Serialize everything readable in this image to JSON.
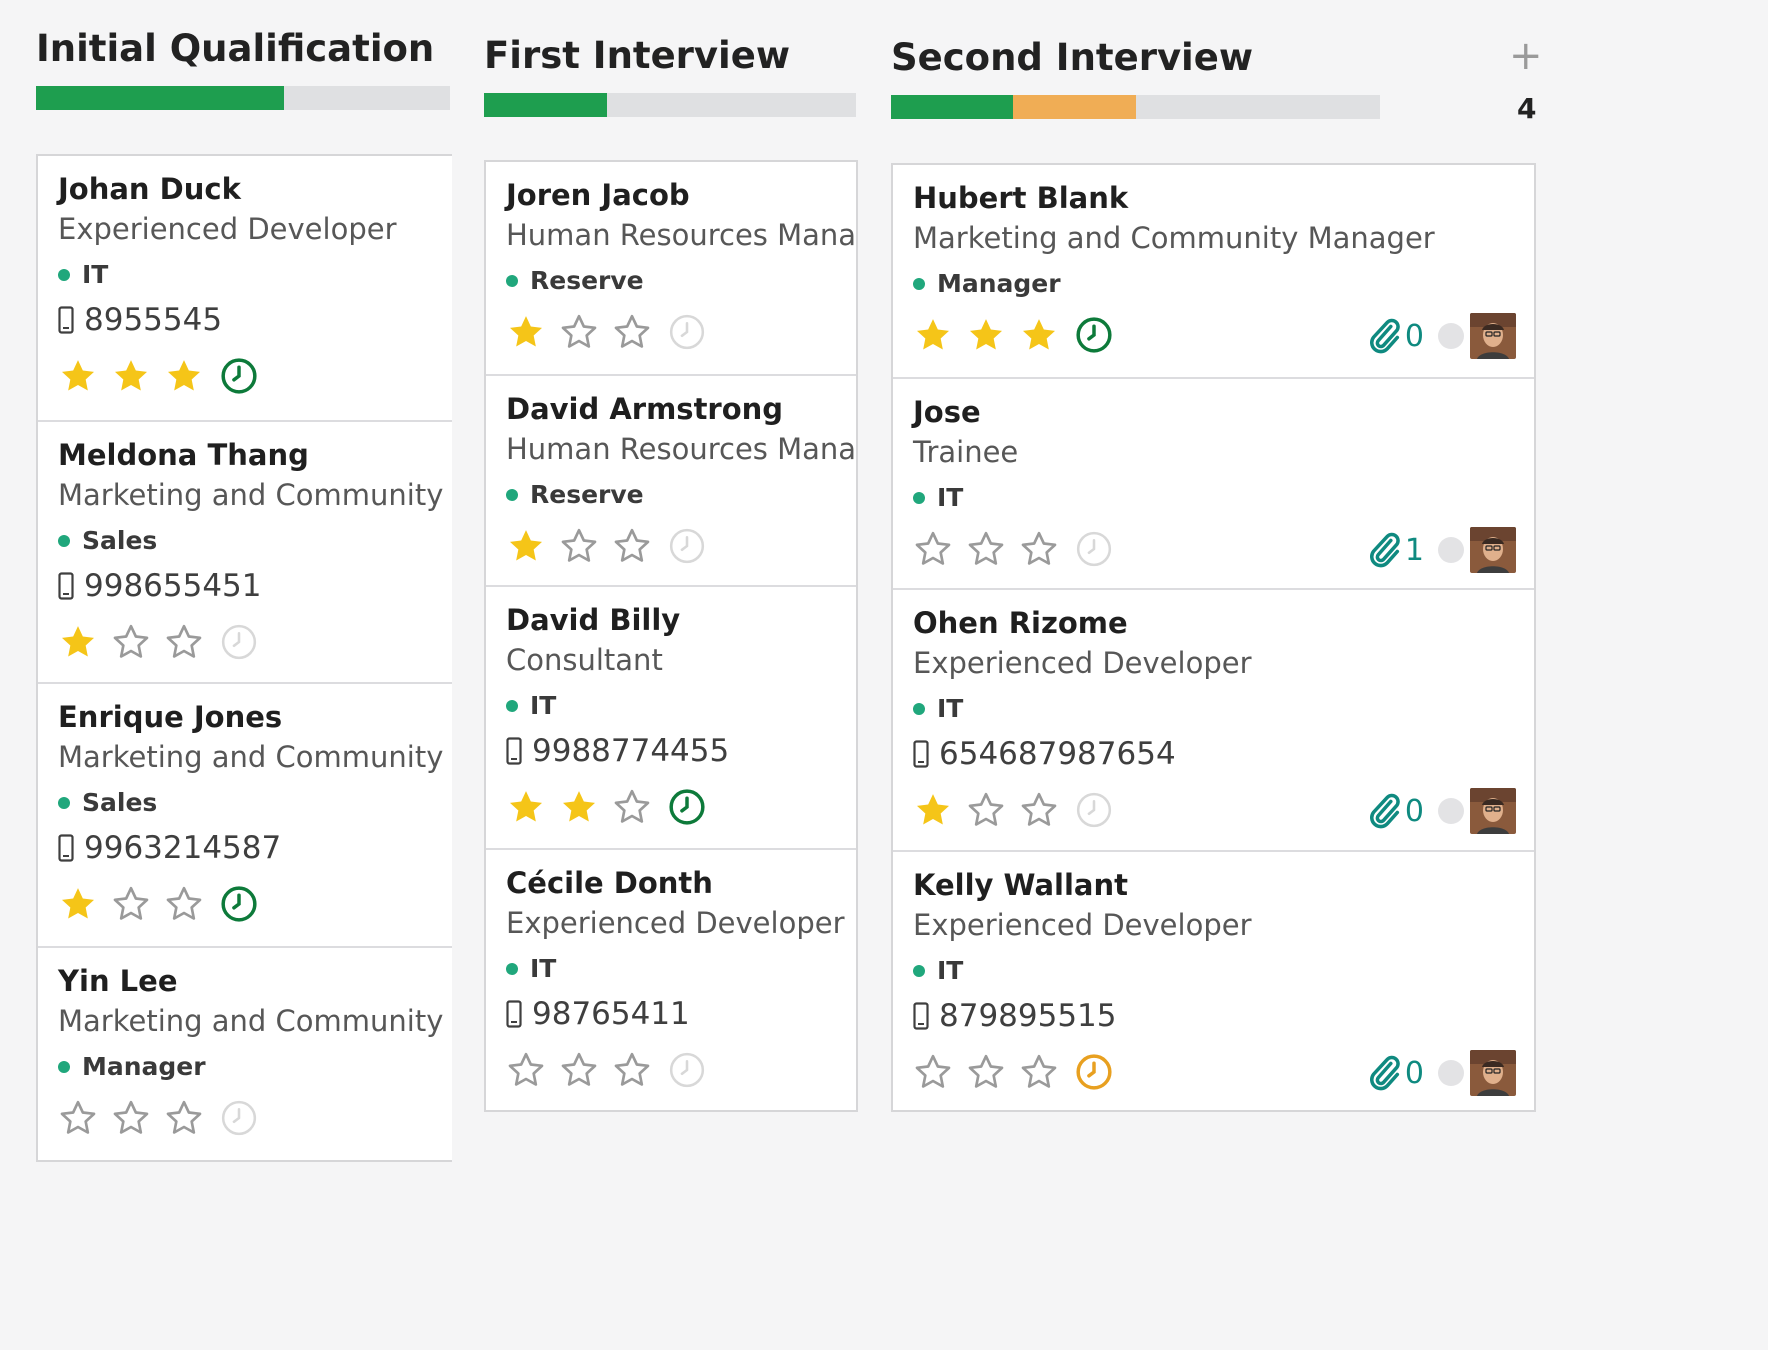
{
  "columns": [
    {
      "title": "Initial Qualification",
      "progress": [
        {
          "color": "#1e9e4f",
          "fraction": 0.6
        }
      ],
      "cards": [
        {
          "name": "Johan Duck",
          "job": "Experienced Developer",
          "tag": "IT",
          "phone": "8955545",
          "stars": 3,
          "activity": "green"
        },
        {
          "name": "Meldona Thang",
          "job": "Marketing and Community Manager",
          "tag": "Sales",
          "phone": "998655451",
          "stars": 1,
          "activity": "none"
        },
        {
          "name": "Enrique Jones",
          "job": "Marketing and Community Manager",
          "tag": "Sales",
          "phone": "9963214587",
          "stars": 1,
          "activity": "green"
        },
        {
          "name": "Yin Lee",
          "job": "Marketing and Community Manager",
          "tag": "Manager",
          "phone": "",
          "stars": 0,
          "activity": "none"
        }
      ]
    },
    {
      "title": "First Interview",
      "progress": [
        {
          "color": "#1e9e4f",
          "fraction": 0.33
        }
      ],
      "cards": [
        {
          "name": "Joren Jacob",
          "job": "Human Resources Manager",
          "tag": "Reserve",
          "phone": "",
          "stars": 1,
          "activity": "none"
        },
        {
          "name": "David Armstrong",
          "job": "Human Resources Manager",
          "tag": "Reserve",
          "phone": "",
          "stars": 1,
          "activity": "none"
        },
        {
          "name": "David Billy",
          "job": "Consultant",
          "tag": "IT",
          "phone": "9988774455",
          "stars": 2,
          "activity": "green"
        },
        {
          "name": "Cécile Donth",
          "job": "Experienced Developer",
          "tag": "IT",
          "phone": "98765411",
          "stars": 0,
          "activity": "none"
        }
      ]
    },
    {
      "title": "Second Interview",
      "add_symbol": "+",
      "count": "4",
      "progress": [
        {
          "color": "#1e9e4f",
          "fraction": 0.25
        },
        {
          "color": "#f0ad55",
          "fraction": 0.25
        }
      ],
      "cards": [
        {
          "name": "Hubert Blank",
          "job": "Marketing and Community Manager",
          "tag": "Manager",
          "phone": "",
          "stars": 3,
          "activity": "green",
          "attachments": "0"
        },
        {
          "name": "Jose",
          "job": "Trainee",
          "tag": "IT",
          "phone": "",
          "stars": 0,
          "activity": "none",
          "attachments": "1"
        },
        {
          "name": "Ohen Rizome",
          "job": "Experienced Developer",
          "tag": "IT",
          "phone": "654687987654",
          "stars": 1,
          "activity": "none",
          "attachments": "0"
        },
        {
          "name": "Kelly Wallant",
          "job": "Experienced Developer",
          "tag": "IT",
          "phone": "879895515",
          "stars": 0,
          "activity": "orange",
          "attachments": "0"
        }
      ]
    }
  ],
  "colors": {
    "star_on": "#f5c518",
    "star_off": "#9a9a9a",
    "activity_green": "#0d7a3a",
    "activity_orange": "#e8a020",
    "activity_none": "#d8d8d8",
    "tag_dot": "#20a77c",
    "attach": "#0f8a80"
  },
  "icons": {
    "phone": "mobile-phone-icon",
    "star": "star-icon",
    "clock": "clock-icon",
    "attachment": "paperclip-icon",
    "avatar": "user-avatar"
  }
}
